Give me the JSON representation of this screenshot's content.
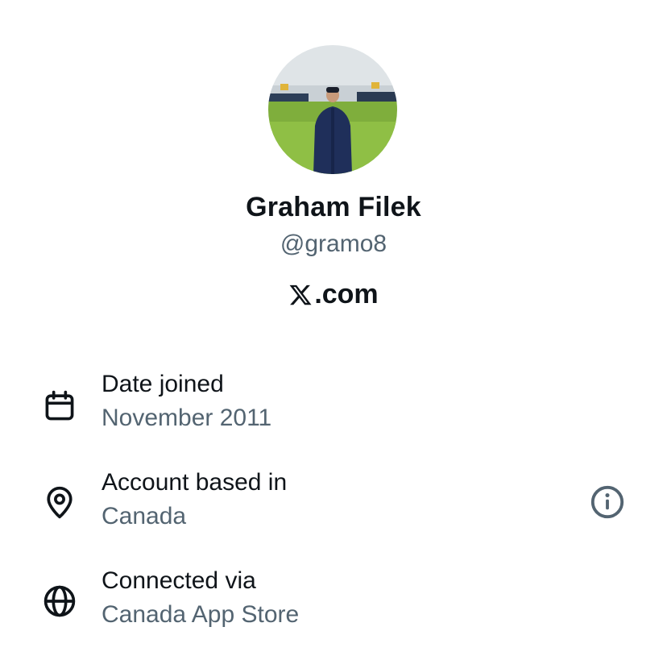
{
  "profile": {
    "display_name": "Graham Filek",
    "handle": "@gramo8",
    "avatar_icon": "profile-photo"
  },
  "brand": {
    "icon": "x-logo-icon",
    "text": ".com"
  },
  "details": [
    {
      "icon": "calendar-icon",
      "title": "Date joined",
      "value": "November 2011"
    },
    {
      "icon": "location-pin-icon",
      "title": "Account based in",
      "value": "Canada"
    },
    {
      "icon": "globe-icon",
      "title": "Connected via",
      "value": "Canada App Store"
    }
  ],
  "colors": {
    "primary_text": "#0f1419",
    "secondary_text": "#536471",
    "background": "#ffffff"
  }
}
